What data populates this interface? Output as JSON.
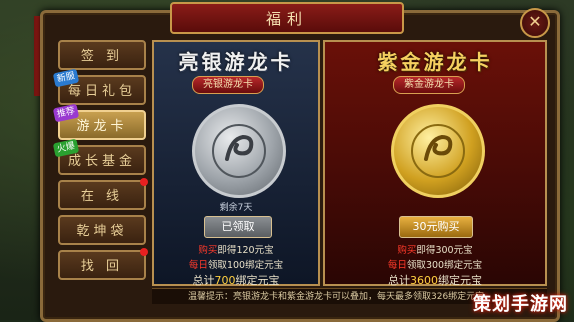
{
  "window": {
    "title": "福利",
    "close_icon": "close-icon"
  },
  "menu": [
    {
      "label": "签 到",
      "tag": "",
      "dot": false,
      "active": false
    },
    {
      "label": "每日礼包",
      "tag": "新服",
      "tag_color": "#2a7ad0",
      "dot": false,
      "active": false
    },
    {
      "label": "游龙卡",
      "tag": "推荐",
      "tag_color": "#9a3ad0",
      "dot": false,
      "active": true
    },
    {
      "label": "成长基金",
      "tag": "火爆",
      "tag_color": "#2aa030",
      "dot": false,
      "active": false
    },
    {
      "label": "在 线",
      "tag": "",
      "dot": true,
      "active": false
    },
    {
      "label": "乾坤袋",
      "tag": "",
      "dot": false,
      "active": false
    },
    {
      "label": "找 回",
      "tag": "",
      "dot": true,
      "active": false
    }
  ],
  "cards": {
    "silver": {
      "title": "亮银游龙卡",
      "subtitle": "亮银游龙卡",
      "remaining": "剩余7天",
      "button": "已领取",
      "buy_prefix": "购买",
      "buy_rest": "即得",
      "buy_num": "120",
      "buy_unit": "元宝",
      "daily_prefix": "每日",
      "daily_rest": "领取",
      "daily_num": "100",
      "daily_unit": "绑定元宝",
      "total_prefix": "总计",
      "total_num": "700",
      "total_unit": "绑定元宝"
    },
    "gold": {
      "title": "紫金游龙卡",
      "subtitle": "紫金游龙卡",
      "button": "30元购买",
      "buy_prefix": "购买",
      "buy_rest": "即得",
      "buy_num": "300",
      "buy_unit": "元宝",
      "daily_prefix": "每日",
      "daily_rest": "领取",
      "daily_num": "300",
      "daily_unit": "绑定元宝",
      "total_prefix": "总计",
      "total_num": "3600",
      "total_unit": "绑定元宝"
    }
  },
  "tip": "温馨提示：亮银游龙卡和紫金游龙卡可以叠加，每天最多领取326绑定元宝",
  "watermark": "策划手游网",
  "colors": {
    "accent_gold": "#c89848",
    "highlight_red": "#ff3a2a"
  }
}
